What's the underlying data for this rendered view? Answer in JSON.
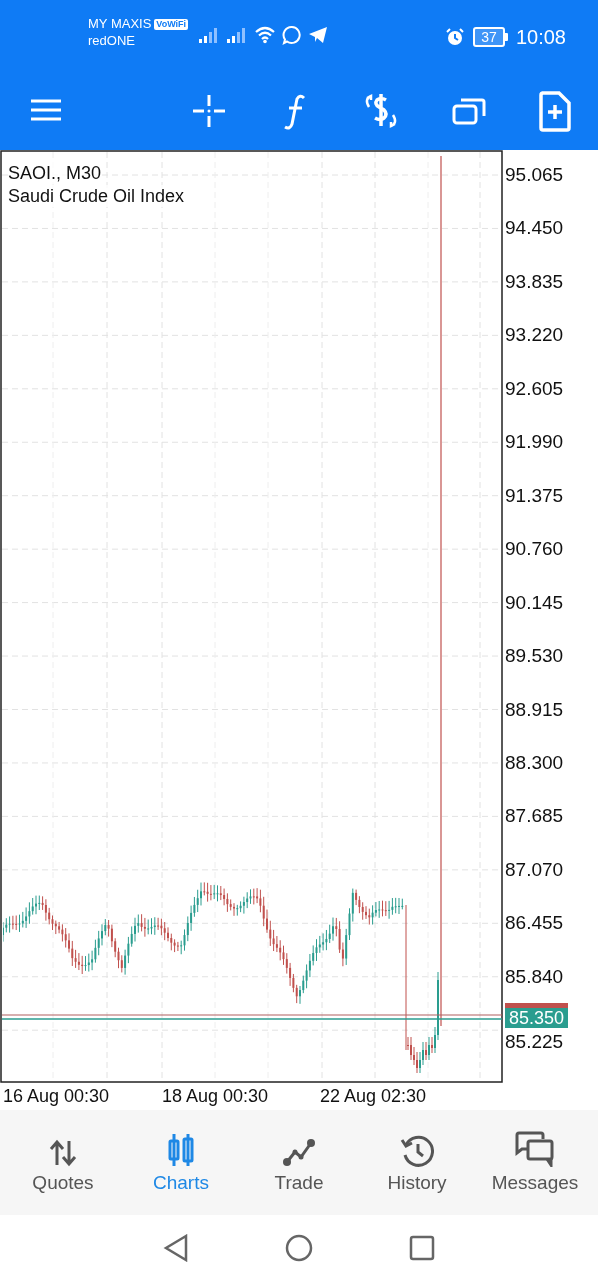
{
  "status_bar": {
    "carrier": "MY MAXIS",
    "carrier_badge": "VoWiFi",
    "carrier_2": "redONE",
    "battery": "37",
    "time": "10:08"
  },
  "chart": {
    "symbol": "SAOI., M30",
    "name": "Saudi Crude Oil Index",
    "price_labels": [
      "95.065",
      "94.450",
      "93.835",
      "93.220",
      "92.605",
      "91.990",
      "91.375",
      "90.760",
      "90.145",
      "89.530",
      "88.915",
      "88.300",
      "87.685",
      "87.070",
      "86.455",
      "85.840",
      "85.225"
    ],
    "time_labels": [
      "16 Aug 00:30",
      "18 Aug 00:30",
      "22 Aug 02:30"
    ],
    "current_price": "85.350"
  },
  "tabs": [
    {
      "label": "Quotes",
      "selected": false
    },
    {
      "label": "Charts",
      "selected": true
    },
    {
      "label": "Trade",
      "selected": false
    },
    {
      "label": "History",
      "selected": false
    },
    {
      "label": "Messages",
      "selected": false
    }
  ]
}
